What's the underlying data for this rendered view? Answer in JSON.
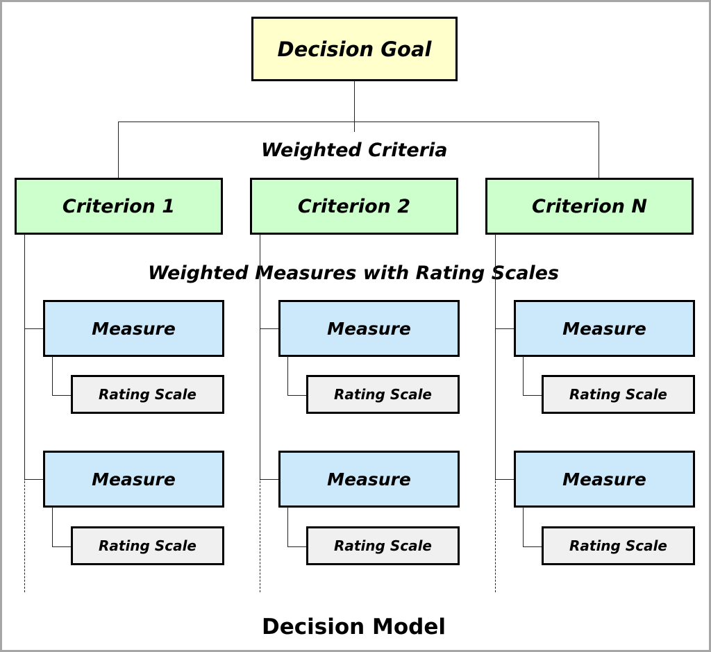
{
  "diagram": {
    "goal": "Decision Goal",
    "criteria_label": "Weighted Criteria",
    "measures_label": "Weighted Measures with Rating Scales",
    "criteria": [
      {
        "label": "Criterion 1",
        "measures": [
          {
            "label": "Measure",
            "scale": "Rating Scale"
          },
          {
            "label": "Measure",
            "scale": "Rating Scale"
          }
        ]
      },
      {
        "label": "Criterion 2",
        "measures": [
          {
            "label": "Measure",
            "scale": "Rating Scale"
          },
          {
            "label": "Measure",
            "scale": "Rating Scale"
          }
        ]
      },
      {
        "label": "Criterion N",
        "measures": [
          {
            "label": "Measure",
            "scale": "Rating Scale"
          },
          {
            "label": "Measure",
            "scale": "Rating Scale"
          }
        ]
      }
    ],
    "title": "Decision Model",
    "colors": {
      "goal_fill": "#FFFFCC",
      "criterion_fill": "#CCFFCC",
      "measure_fill": "#CCE9FC",
      "rating_fill": "#F0F0F0",
      "frame": "#A6A6A6"
    }
  }
}
